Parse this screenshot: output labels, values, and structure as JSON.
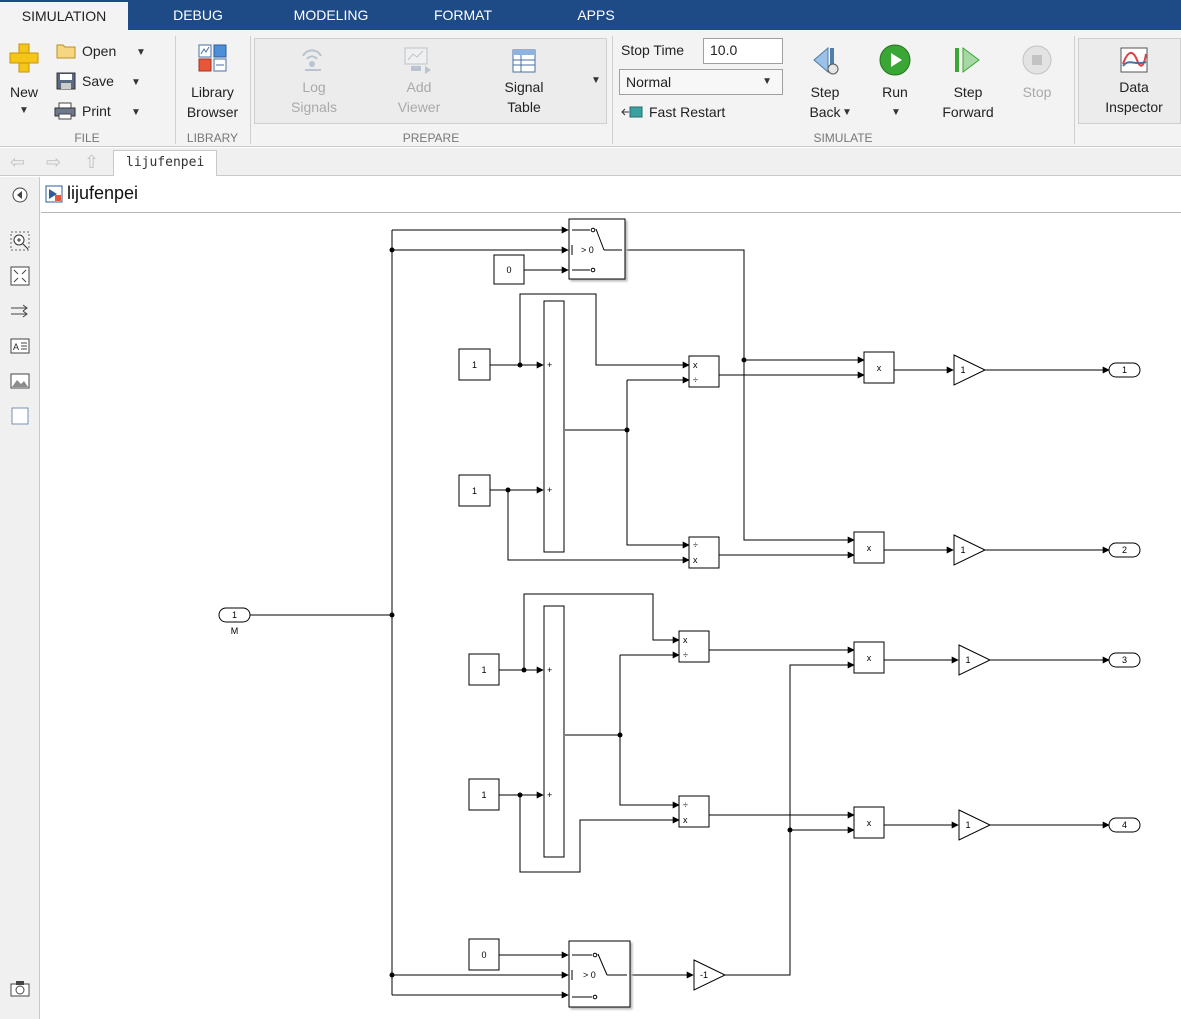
{
  "tabs": [
    {
      "label": "SIMULATION",
      "active": true
    },
    {
      "label": "DEBUG"
    },
    {
      "label": "MODELING"
    },
    {
      "label": "FORMAT"
    },
    {
      "label": "APPS"
    }
  ],
  "ribbon": {
    "file": {
      "label": "FILE",
      "new": "New",
      "open": "Open",
      "save": "Save",
      "print": "Print"
    },
    "library": {
      "label": "LIBRARY",
      "library_browser_l1": "Library",
      "library_browser_l2": "Browser"
    },
    "prepare": {
      "label": "PREPARE",
      "log_signals_l1": "Log",
      "log_signals_l2": "Signals",
      "add_viewer_l1": "Add",
      "add_viewer_l2": "Viewer",
      "signal_table_l1": "Signal",
      "signal_table_l2": "Table"
    },
    "simulate": {
      "label": "SIMULATE",
      "stop_time_label": "Stop Time",
      "stop_time_value": "10.0",
      "mode": "Normal",
      "fast_restart": "Fast Restart",
      "step_back_l1": "Step",
      "step_back_l2": "Back",
      "run": "Run",
      "step_forward_l1": "Step",
      "step_forward_l2": "Forward",
      "stop": "Stop"
    },
    "review": {
      "data_inspector_l1": "Data",
      "data_inspector_l2": "Inspector"
    }
  },
  "address": {
    "breadcrumb": "lijufenpei"
  },
  "model": {
    "title": "lijufenpei"
  },
  "diagram": {
    "inport_number": "1",
    "inport_name": "M",
    "switch_criterion": "> 0",
    "const_zero": "0",
    "const_one": "1",
    "sum_plus": "+",
    "prod_mul": "x",
    "prod_div": "÷",
    "gain_value": "1",
    "neg_gain_value": "-1",
    "outports": [
      "1",
      "2",
      "3",
      "4"
    ]
  },
  "colors": {
    "tab_bar": "#1e4a86",
    "ribbon_bg": "#f3f3f3",
    "run_green": "#3aa635"
  }
}
